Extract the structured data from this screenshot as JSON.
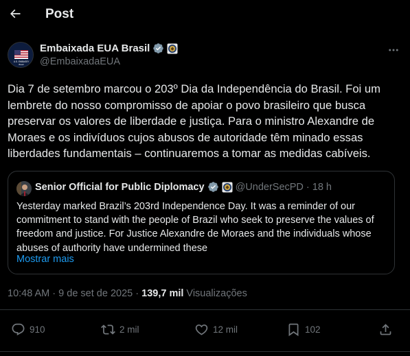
{
  "header": {
    "title": "Post"
  },
  "author": {
    "name": "Embaixada EUA Brasil",
    "handle": "@EmbaixadaEUA",
    "avatar_text": "U.S. EMBASSY",
    "avatar_subtext": "Brasil"
  },
  "tweet": {
    "text": "Dia 7 de setembro marcou o 203º Dia da Independência do Brasil. Foi um lembrete do nosso compromisso de apoiar o povo brasileiro que busca preservar os valores de liberdade e justiça. Para o ministro Alexandre de Moraes e os indivíduos cujos abusos de autoridade têm minado essas liberdades fundamentais – continuaremos a tomar as medidas cabíveis."
  },
  "quote": {
    "name": "Senior Official for Public Diplomacy",
    "handle": "@UnderSecPD",
    "separator": "·",
    "time": "18 h",
    "text": "Yesterday marked Brazil’s 203rd Independence Day. It was a reminder of our commitment to stand with the people of Brazil who seek to preserve the values of freedom and justice. For Justice Alexandre de Moraes and the individuals whose abuses of authority have undermined these",
    "show_more": "Mostrar mais"
  },
  "meta": {
    "time": "10:48 AM",
    "separator1": "·",
    "date": "9 de set de 2025",
    "separator2": "·",
    "views_count": "139,7 mil",
    "views_label": "Visualizações"
  },
  "actions": {
    "replies": "910",
    "reposts": "2 mil",
    "likes": "12 mil",
    "bookmarks": "102"
  },
  "colors": {
    "background": "#000000",
    "text": "#e7e9ea",
    "muted": "#71767b",
    "accent": "#1d9bf0",
    "border": "#2f3336",
    "verified_gray": "#829aab"
  },
  "icons": {
    "back": "arrow-left-icon",
    "verified": "verified-badge-icon",
    "affiliate": "embassy-seal-icon",
    "more": "more-dots-icon",
    "reply": "reply-bubble-icon",
    "repost": "repost-icon",
    "like": "heart-icon",
    "bookmark": "bookmark-icon",
    "share": "share-icon"
  }
}
